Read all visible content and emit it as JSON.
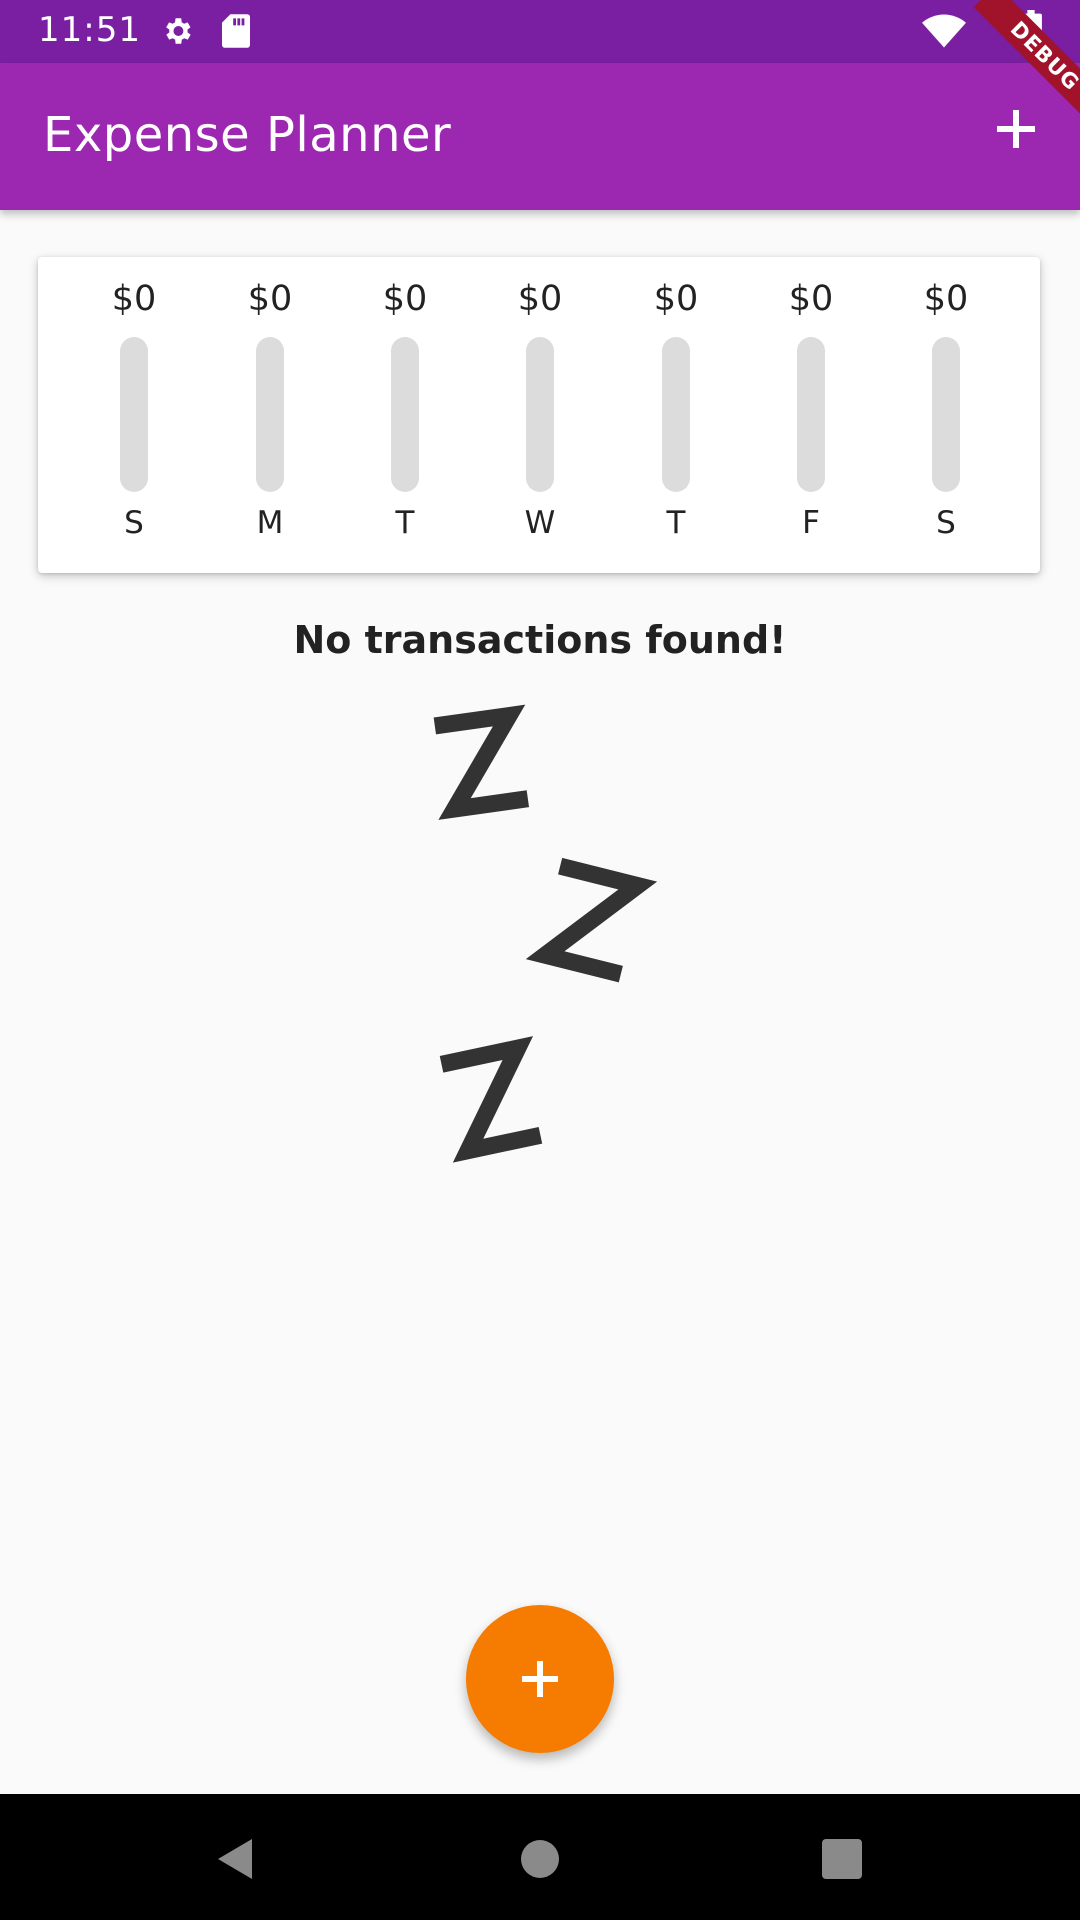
{
  "status_bar": {
    "time": "11:51",
    "icons": [
      "settings-icon",
      "sd-card-icon",
      "wifi-icon",
      "battery-icon"
    ],
    "debug_banner": "DEBUG"
  },
  "app_bar": {
    "title": "Expense Planner",
    "action_icon": "add-icon",
    "background": "#9c27b0"
  },
  "chart": {
    "bars": [
      {
        "amount": "$0",
        "day": "S",
        "fraction": 0
      },
      {
        "amount": "$0",
        "day": "M",
        "fraction": 0
      },
      {
        "amount": "$0",
        "day": "T",
        "fraction": 0
      },
      {
        "amount": "$0",
        "day": "W",
        "fraction": 0
      },
      {
        "amount": "$0",
        "day": "T",
        "fraction": 0
      },
      {
        "amount": "$0",
        "day": "F",
        "fraction": 0
      },
      {
        "amount": "$0",
        "day": "S",
        "fraction": 0
      }
    ],
    "track_color": "#dcdcdc",
    "fill_color": "#9c27b0"
  },
  "empty_state": {
    "message": "No transactions found!",
    "illustration": "zzz-sleep-image"
  },
  "fab": {
    "icon": "add-icon",
    "color": "#f57c00"
  },
  "nav_bar": {
    "icons": [
      "back-icon",
      "home-icon",
      "recents-icon"
    ]
  }
}
